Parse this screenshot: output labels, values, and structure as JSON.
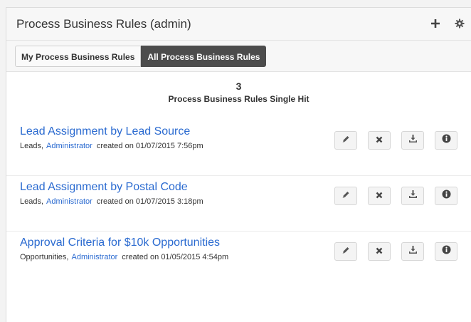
{
  "panel": {
    "title": "Process Business Rules (admin)",
    "icons": [
      "plus-icon",
      "gear-icon"
    ]
  },
  "tabs": [
    {
      "label": "My Process Business Rules",
      "active": false
    },
    {
      "label": "All Process Business Rules",
      "active": true
    }
  ],
  "summary": {
    "count": "3",
    "label": "Process Business Rules Single Hit"
  },
  "rules": [
    {
      "title": "Lead Assignment by Lead Source",
      "object": "Leads,",
      "owner": "Administrator",
      "created": "created on 01/07/2015 7:56pm"
    },
    {
      "title": "Lead Assignment by Postal Code",
      "object": "Leads,",
      "owner": "Administrator",
      "created": "created on 01/07/2015 3:18pm"
    },
    {
      "title": "Approval Criteria for $10k Opportunities",
      "object": "Opportunities,",
      "owner": "Administrator",
      "created": "created on 01/05/2015 4:54pm"
    }
  ],
  "row_actions": [
    "pencil-icon",
    "times-icon",
    "download-icon",
    "info-icon"
  ],
  "colors": {
    "link": "#2a6ad0",
    "active_tab": "#4c4c4c",
    "icon": "#444444"
  }
}
